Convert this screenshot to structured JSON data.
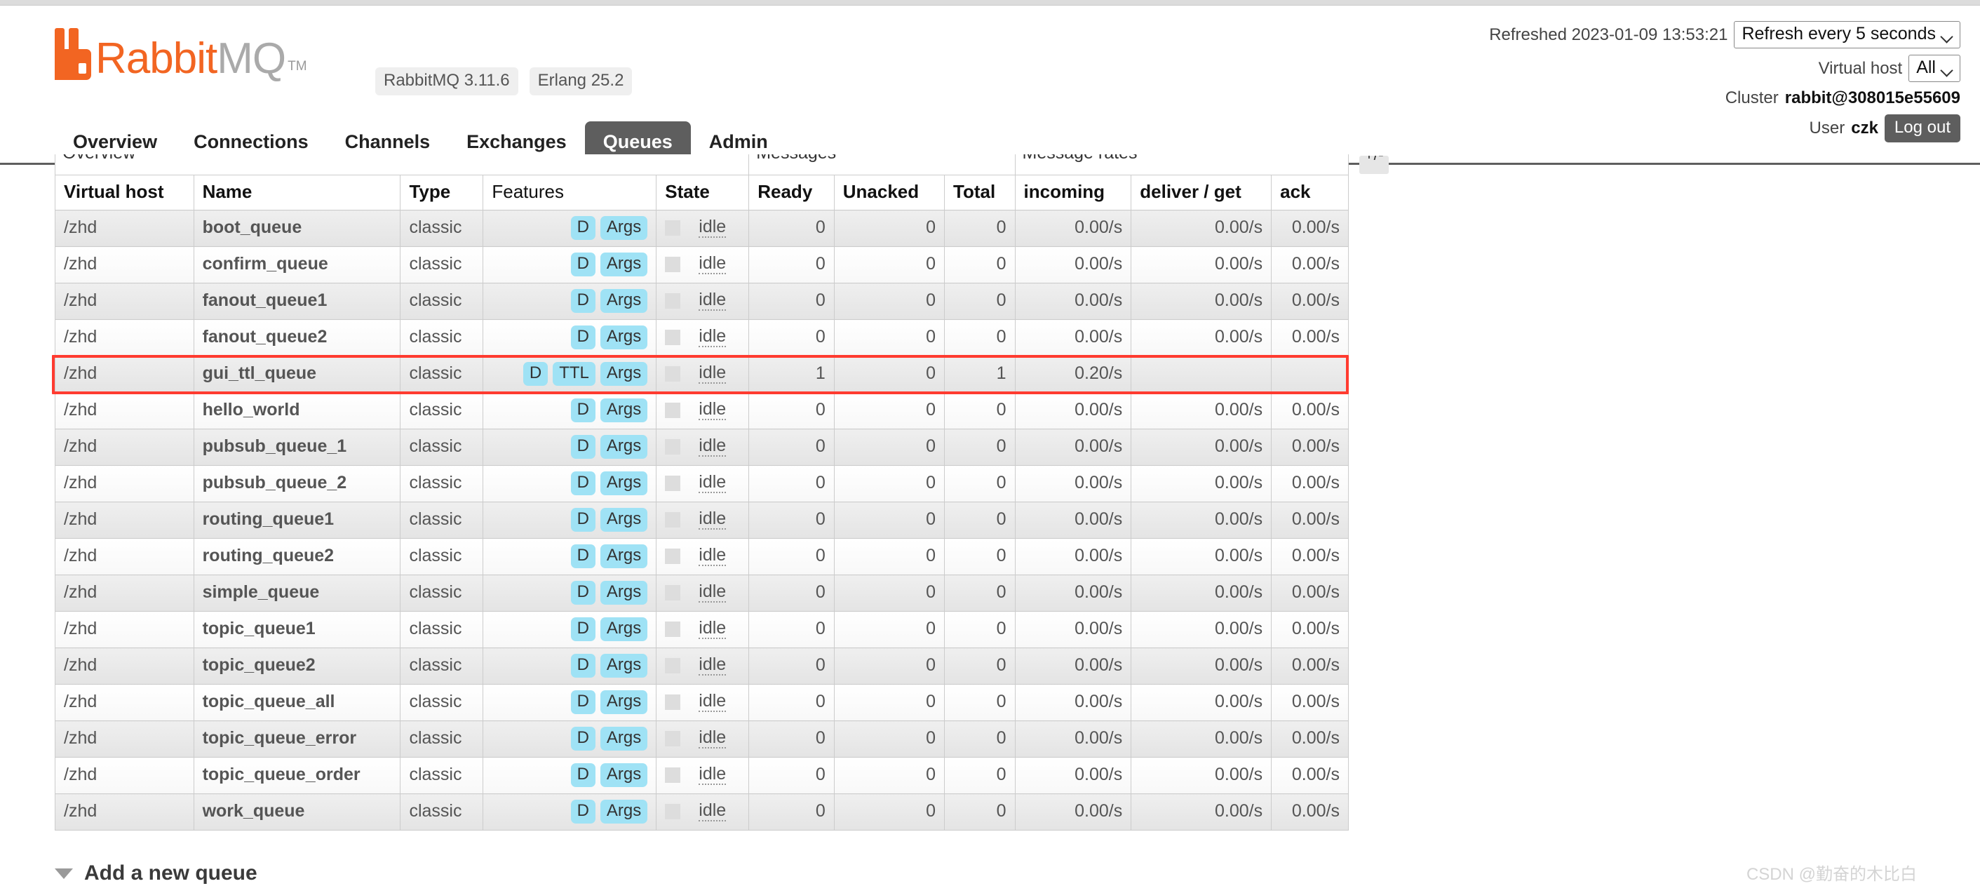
{
  "app": {
    "logo_rabbit": "Rabbit",
    "logo_mq": "MQ",
    "logo_tm": "TM",
    "version_rabbitmq": "RabbitMQ 3.11.6",
    "version_erlang": "Erlang 25.2"
  },
  "header_right": {
    "refreshed_label": "Refreshed 2023-01-09 13:53:21",
    "refresh_select_value": "Refresh every 5 seconds",
    "vhost_label": "Virtual host",
    "vhost_select_value": "All",
    "cluster_label": "Cluster",
    "cluster_name": "rabbit@308015e55609",
    "user_label": "User",
    "user_name": "czk",
    "logout_label": "Log out"
  },
  "nav": {
    "tabs": [
      {
        "label": "Overview",
        "active": false
      },
      {
        "label": "Connections",
        "active": false
      },
      {
        "label": "Channels",
        "active": false
      },
      {
        "label": "Exchanges",
        "active": false
      },
      {
        "label": "Queues",
        "active": true
      },
      {
        "label": "Admin",
        "active": false
      }
    ]
  },
  "table": {
    "group_headers": {
      "overview": "Overview",
      "messages": "Messages",
      "message_rates": "Message rates",
      "toggle": "+/-"
    },
    "columns": [
      "Virtual host",
      "Name",
      "Type",
      "Features",
      "State",
      "Ready",
      "Unacked",
      "Total",
      "incoming",
      "deliver / get",
      "ack"
    ],
    "rows": [
      {
        "vhost": "/zhd",
        "name": "boot_queue",
        "type": "classic",
        "features": [
          "D",
          "Args"
        ],
        "state": "idle",
        "ready": "0",
        "unacked": "0",
        "total": "0",
        "incoming": "0.00/s",
        "deliver_get": "0.00/s",
        "ack": "0.00/s",
        "highlighted": false
      },
      {
        "vhost": "/zhd",
        "name": "confirm_queue",
        "type": "classic",
        "features": [
          "D",
          "Args"
        ],
        "state": "idle",
        "ready": "0",
        "unacked": "0",
        "total": "0",
        "incoming": "0.00/s",
        "deliver_get": "0.00/s",
        "ack": "0.00/s",
        "highlighted": false
      },
      {
        "vhost": "/zhd",
        "name": "fanout_queue1",
        "type": "classic",
        "features": [
          "D",
          "Args"
        ],
        "state": "idle",
        "ready": "0",
        "unacked": "0",
        "total": "0",
        "incoming": "0.00/s",
        "deliver_get": "0.00/s",
        "ack": "0.00/s",
        "highlighted": false
      },
      {
        "vhost": "/zhd",
        "name": "fanout_queue2",
        "type": "classic",
        "features": [
          "D",
          "Args"
        ],
        "state": "idle",
        "ready": "0",
        "unacked": "0",
        "total": "0",
        "incoming": "0.00/s",
        "deliver_get": "0.00/s",
        "ack": "0.00/s",
        "highlighted": false
      },
      {
        "vhost": "/zhd",
        "name": "gui_ttl_queue",
        "type": "classic",
        "features": [
          "D",
          "TTL",
          "Args"
        ],
        "state": "idle",
        "ready": "1",
        "unacked": "0",
        "total": "1",
        "incoming": "0.20/s",
        "deliver_get": "",
        "ack": "",
        "highlighted": true
      },
      {
        "vhost": "/zhd",
        "name": "hello_world",
        "type": "classic",
        "features": [
          "D",
          "Args"
        ],
        "state": "idle",
        "ready": "0",
        "unacked": "0",
        "total": "0",
        "incoming": "0.00/s",
        "deliver_get": "0.00/s",
        "ack": "0.00/s",
        "highlighted": false
      },
      {
        "vhost": "/zhd",
        "name": "pubsub_queue_1",
        "type": "classic",
        "features": [
          "D",
          "Args"
        ],
        "state": "idle",
        "ready": "0",
        "unacked": "0",
        "total": "0",
        "incoming": "0.00/s",
        "deliver_get": "0.00/s",
        "ack": "0.00/s",
        "highlighted": false
      },
      {
        "vhost": "/zhd",
        "name": "pubsub_queue_2",
        "type": "classic",
        "features": [
          "D",
          "Args"
        ],
        "state": "idle",
        "ready": "0",
        "unacked": "0",
        "total": "0",
        "incoming": "0.00/s",
        "deliver_get": "0.00/s",
        "ack": "0.00/s",
        "highlighted": false
      },
      {
        "vhost": "/zhd",
        "name": "routing_queue1",
        "type": "classic",
        "features": [
          "D",
          "Args"
        ],
        "state": "idle",
        "ready": "0",
        "unacked": "0",
        "total": "0",
        "incoming": "0.00/s",
        "deliver_get": "0.00/s",
        "ack": "0.00/s",
        "highlighted": false
      },
      {
        "vhost": "/zhd",
        "name": "routing_queue2",
        "type": "classic",
        "features": [
          "D",
          "Args"
        ],
        "state": "idle",
        "ready": "0",
        "unacked": "0",
        "total": "0",
        "incoming": "0.00/s",
        "deliver_get": "0.00/s",
        "ack": "0.00/s",
        "highlighted": false
      },
      {
        "vhost": "/zhd",
        "name": "simple_queue",
        "type": "classic",
        "features": [
          "D",
          "Args"
        ],
        "state": "idle",
        "ready": "0",
        "unacked": "0",
        "total": "0",
        "incoming": "0.00/s",
        "deliver_get": "0.00/s",
        "ack": "0.00/s",
        "highlighted": false
      },
      {
        "vhost": "/zhd",
        "name": "topic_queue1",
        "type": "classic",
        "features": [
          "D",
          "Args"
        ],
        "state": "idle",
        "ready": "0",
        "unacked": "0",
        "total": "0",
        "incoming": "0.00/s",
        "deliver_get": "0.00/s",
        "ack": "0.00/s",
        "highlighted": false
      },
      {
        "vhost": "/zhd",
        "name": "topic_queue2",
        "type": "classic",
        "features": [
          "D",
          "Args"
        ],
        "state": "idle",
        "ready": "0",
        "unacked": "0",
        "total": "0",
        "incoming": "0.00/s",
        "deliver_get": "0.00/s",
        "ack": "0.00/s",
        "highlighted": false
      },
      {
        "vhost": "/zhd",
        "name": "topic_queue_all",
        "type": "classic",
        "features": [
          "D",
          "Args"
        ],
        "state": "idle",
        "ready": "0",
        "unacked": "0",
        "total": "0",
        "incoming": "0.00/s",
        "deliver_get": "0.00/s",
        "ack": "0.00/s",
        "highlighted": false
      },
      {
        "vhost": "/zhd",
        "name": "topic_queue_error",
        "type": "classic",
        "features": [
          "D",
          "Args"
        ],
        "state": "idle",
        "ready": "0",
        "unacked": "0",
        "total": "0",
        "incoming": "0.00/s",
        "deliver_get": "0.00/s",
        "ack": "0.00/s",
        "highlighted": false
      },
      {
        "vhost": "/zhd",
        "name": "topic_queue_order",
        "type": "classic",
        "features": [
          "D",
          "Args"
        ],
        "state": "idle",
        "ready": "0",
        "unacked": "0",
        "total": "0",
        "incoming": "0.00/s",
        "deliver_get": "0.00/s",
        "ack": "0.00/s",
        "highlighted": false
      },
      {
        "vhost": "/zhd",
        "name": "work_queue",
        "type": "classic",
        "features": [
          "D",
          "Args"
        ],
        "state": "idle",
        "ready": "0",
        "unacked": "0",
        "total": "0",
        "incoming": "0.00/s",
        "deliver_get": "0.00/s",
        "ack": "0.00/s",
        "highlighted": false
      }
    ]
  },
  "footer": {
    "add_queue_label": "Add a new queue",
    "watermark": "CSDN @勤奋的木比白"
  },
  "colors": {
    "brand_orange": "#F26522",
    "badge_blue": "#9FE2F5",
    "active_tab": "#5E5E5E",
    "highlight_red": "#FF3B30"
  }
}
